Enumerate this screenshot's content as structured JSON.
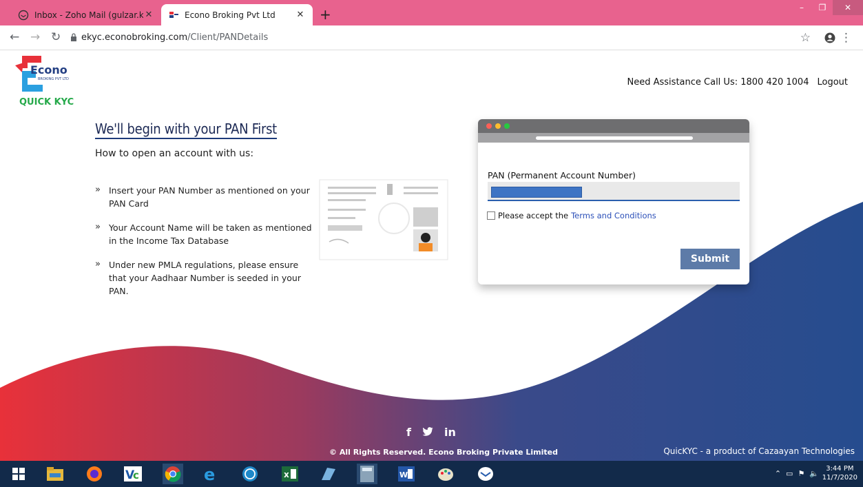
{
  "browser": {
    "tabs": [
      {
        "title": "Inbox - Zoho Mail (gulzar.kardon",
        "active": false
      },
      {
        "title": "Econo Broking Pvt Ltd",
        "active": true
      }
    ],
    "new_tab": "+",
    "url_domain": "ekyc.econobroking.com",
    "url_path": "/Client/PANDetails"
  },
  "header": {
    "logo_text": "QUICK KYC",
    "assistance": "Need Assistance Call Us: 1800 420 1004",
    "logout": "Logout"
  },
  "main": {
    "title": "We'll begin with your PAN First",
    "subtitle": "How to open an account with us:",
    "steps": [
      "Insert your PAN Number as mentioned on your PAN Card",
      "Your Account Name will be taken as mentioned in the Income Tax Database",
      "Under new PMLA regulations, please ensure that your Aadhaar Number is seeded in your PAN."
    ]
  },
  "form": {
    "pan_label": "PAN (Permanent Account Number)",
    "terms_prefix": "Please accept the",
    "terms_link": "Terms and Conditions",
    "submit": "Submit"
  },
  "footer": {
    "social": [
      "f",
      "✦",
      "in"
    ],
    "copyright": "© All Rights Reserved. Econo Broking Private Limited",
    "product": "QuicKYC - a product of Cazaayan Technologies"
  },
  "taskbar": {
    "time": "3:44 PM",
    "date": "11/7/2020"
  },
  "colors": {
    "tabbar": "#e8628e",
    "brand_red": "#e8313a",
    "brand_blue": "#233f83",
    "submit": "#5d7ba8"
  }
}
